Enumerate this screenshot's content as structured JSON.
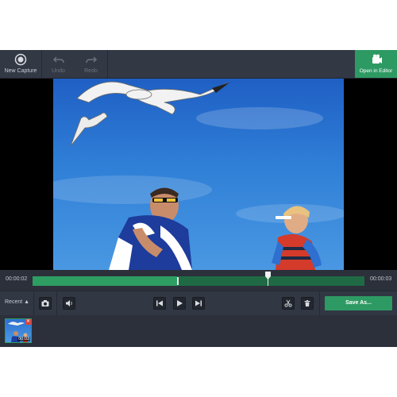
{
  "toolbar": {
    "new_capture": "New Capture",
    "undo": "Undo",
    "redo": "Redo",
    "open_in_editor": "Open in Editor"
  },
  "timeline": {
    "start_time": "00:00:02",
    "end_time": "00:00:03",
    "playhead_fraction": 0.71
  },
  "controls": {
    "recent_label": "Recent",
    "save_as": "Save As..."
  },
  "recent": {
    "thumb_time": "00:03"
  },
  "colors": {
    "accent": "#2e9a63",
    "background": "#2b303a",
    "toolbar": "#323844",
    "close": "#d64541"
  },
  "icons": [
    "record-icon",
    "undo-icon",
    "redo-icon",
    "editor-icon",
    "camera-icon",
    "speaker-icon",
    "skip-back-icon",
    "play-icon",
    "skip-forward-icon",
    "scissors-icon",
    "trash-icon",
    "close-icon"
  ]
}
